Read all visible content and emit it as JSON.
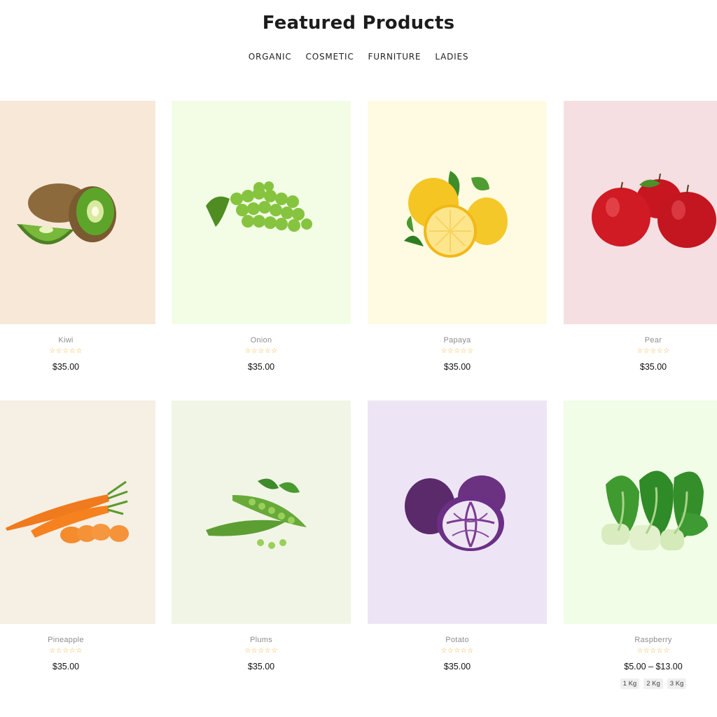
{
  "header": {
    "title": "Featured Products",
    "tabs": [
      "ORGANIC",
      "COSMETIC",
      "FURNITURE",
      "LADIES"
    ]
  },
  "products": [
    {
      "name": "Kiwi",
      "price": "$35.00",
      "rating": 0,
      "bg": "#f7e8d8",
      "icon": "kiwi-image"
    },
    {
      "name": "Onion",
      "price": "$35.00",
      "rating": 0,
      "bg": "#f3fde6",
      "icon": "grapes-image"
    },
    {
      "name": "Papaya",
      "price": "$35.00",
      "rating": 0,
      "bg": "#fffbe3",
      "icon": "lemons-image"
    },
    {
      "name": "Pear",
      "price": "$35.00",
      "rating": 0,
      "bg": "#f6dfe2",
      "icon": "apples-image"
    },
    {
      "name": "Pineapple",
      "price": "$35.00",
      "rating": 0,
      "bg": "#f5efe4",
      "icon": "carrots-image"
    },
    {
      "name": "Plums",
      "price": "$35.00",
      "rating": 0,
      "bg": "#f1f5e6",
      "icon": "peas-image"
    },
    {
      "name": "Potato",
      "price": "$35.00",
      "rating": 0,
      "bg": "#ede5f5",
      "icon": "cabbage-image"
    },
    {
      "name": "Raspberry",
      "price": "$5.00 – $13.00",
      "rating": 0,
      "bg": "#f1fde7",
      "icon": "bok-choy-image",
      "variants": [
        "1 Kg",
        "2 Kg",
        "3 Kg"
      ]
    }
  ],
  "stars_text": "☆☆☆☆☆"
}
